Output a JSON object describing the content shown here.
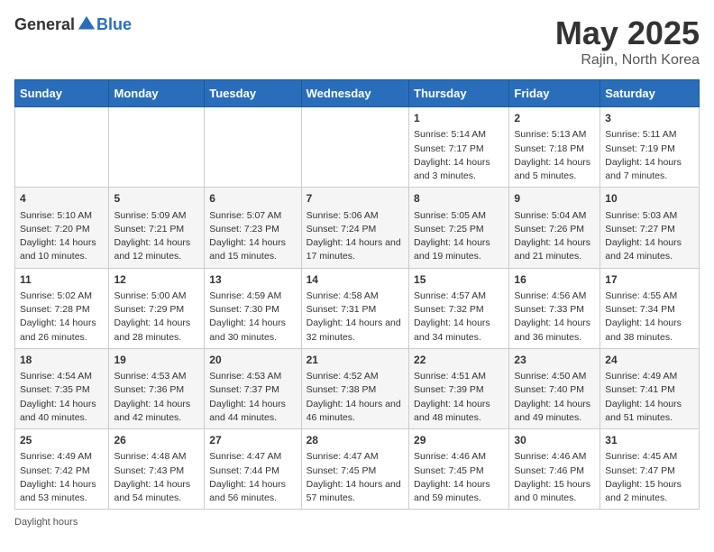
{
  "header": {
    "logo_general": "General",
    "logo_blue": "Blue",
    "month": "May 2025",
    "location": "Rajin, North Korea"
  },
  "days_of_week": [
    "Sunday",
    "Monday",
    "Tuesday",
    "Wednesday",
    "Thursday",
    "Friday",
    "Saturday"
  ],
  "footer": {
    "daylight_label": "Daylight hours"
  },
  "weeks": [
    [
      {
        "day": "",
        "info": ""
      },
      {
        "day": "",
        "info": ""
      },
      {
        "day": "",
        "info": ""
      },
      {
        "day": "",
        "info": ""
      },
      {
        "day": "1",
        "info": "Sunrise: 5:14 AM\nSunset: 7:17 PM\nDaylight: 14 hours and 3 minutes."
      },
      {
        "day": "2",
        "info": "Sunrise: 5:13 AM\nSunset: 7:18 PM\nDaylight: 14 hours and 5 minutes."
      },
      {
        "day": "3",
        "info": "Sunrise: 5:11 AM\nSunset: 7:19 PM\nDaylight: 14 hours and 7 minutes."
      }
    ],
    [
      {
        "day": "4",
        "info": "Sunrise: 5:10 AM\nSunset: 7:20 PM\nDaylight: 14 hours and 10 minutes."
      },
      {
        "day": "5",
        "info": "Sunrise: 5:09 AM\nSunset: 7:21 PM\nDaylight: 14 hours and 12 minutes."
      },
      {
        "day": "6",
        "info": "Sunrise: 5:07 AM\nSunset: 7:23 PM\nDaylight: 14 hours and 15 minutes."
      },
      {
        "day": "7",
        "info": "Sunrise: 5:06 AM\nSunset: 7:24 PM\nDaylight: 14 hours and 17 minutes."
      },
      {
        "day": "8",
        "info": "Sunrise: 5:05 AM\nSunset: 7:25 PM\nDaylight: 14 hours and 19 minutes."
      },
      {
        "day": "9",
        "info": "Sunrise: 5:04 AM\nSunset: 7:26 PM\nDaylight: 14 hours and 21 minutes."
      },
      {
        "day": "10",
        "info": "Sunrise: 5:03 AM\nSunset: 7:27 PM\nDaylight: 14 hours and 24 minutes."
      }
    ],
    [
      {
        "day": "11",
        "info": "Sunrise: 5:02 AM\nSunset: 7:28 PM\nDaylight: 14 hours and 26 minutes."
      },
      {
        "day": "12",
        "info": "Sunrise: 5:00 AM\nSunset: 7:29 PM\nDaylight: 14 hours and 28 minutes."
      },
      {
        "day": "13",
        "info": "Sunrise: 4:59 AM\nSunset: 7:30 PM\nDaylight: 14 hours and 30 minutes."
      },
      {
        "day": "14",
        "info": "Sunrise: 4:58 AM\nSunset: 7:31 PM\nDaylight: 14 hours and 32 minutes."
      },
      {
        "day": "15",
        "info": "Sunrise: 4:57 AM\nSunset: 7:32 PM\nDaylight: 14 hours and 34 minutes."
      },
      {
        "day": "16",
        "info": "Sunrise: 4:56 AM\nSunset: 7:33 PM\nDaylight: 14 hours and 36 minutes."
      },
      {
        "day": "17",
        "info": "Sunrise: 4:55 AM\nSunset: 7:34 PM\nDaylight: 14 hours and 38 minutes."
      }
    ],
    [
      {
        "day": "18",
        "info": "Sunrise: 4:54 AM\nSunset: 7:35 PM\nDaylight: 14 hours and 40 minutes."
      },
      {
        "day": "19",
        "info": "Sunrise: 4:53 AM\nSunset: 7:36 PM\nDaylight: 14 hours and 42 minutes."
      },
      {
        "day": "20",
        "info": "Sunrise: 4:53 AM\nSunset: 7:37 PM\nDaylight: 14 hours and 44 minutes."
      },
      {
        "day": "21",
        "info": "Sunrise: 4:52 AM\nSunset: 7:38 PM\nDaylight: 14 hours and 46 minutes."
      },
      {
        "day": "22",
        "info": "Sunrise: 4:51 AM\nSunset: 7:39 PM\nDaylight: 14 hours and 48 minutes."
      },
      {
        "day": "23",
        "info": "Sunrise: 4:50 AM\nSunset: 7:40 PM\nDaylight: 14 hours and 49 minutes."
      },
      {
        "day": "24",
        "info": "Sunrise: 4:49 AM\nSunset: 7:41 PM\nDaylight: 14 hours and 51 minutes."
      }
    ],
    [
      {
        "day": "25",
        "info": "Sunrise: 4:49 AM\nSunset: 7:42 PM\nDaylight: 14 hours and 53 minutes."
      },
      {
        "day": "26",
        "info": "Sunrise: 4:48 AM\nSunset: 7:43 PM\nDaylight: 14 hours and 54 minutes."
      },
      {
        "day": "27",
        "info": "Sunrise: 4:47 AM\nSunset: 7:44 PM\nDaylight: 14 hours and 56 minutes."
      },
      {
        "day": "28",
        "info": "Sunrise: 4:47 AM\nSunset: 7:45 PM\nDaylight: 14 hours and 57 minutes."
      },
      {
        "day": "29",
        "info": "Sunrise: 4:46 AM\nSunset: 7:45 PM\nDaylight: 14 hours and 59 minutes."
      },
      {
        "day": "30",
        "info": "Sunrise: 4:46 AM\nSunset: 7:46 PM\nDaylight: 15 hours and 0 minutes."
      },
      {
        "day": "31",
        "info": "Sunrise: 4:45 AM\nSunset: 7:47 PM\nDaylight: 15 hours and 2 minutes."
      }
    ]
  ]
}
